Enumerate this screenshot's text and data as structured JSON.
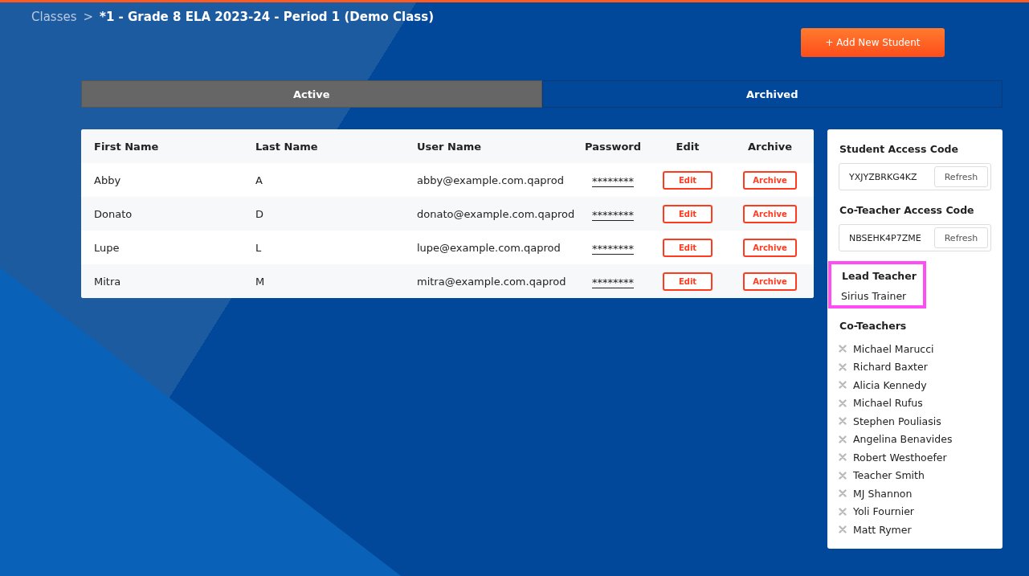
{
  "breadcrumb": {
    "parent": "Classes",
    "separator": ">",
    "current": "*1 - Grade 8 ELA 2023-24 - Period 1 (Demo Class)"
  },
  "add_button": {
    "label": "+ Add New Student"
  },
  "tabs": [
    {
      "label": "Active",
      "selected": true
    },
    {
      "label": "Archived",
      "selected": false
    }
  ],
  "table": {
    "columns": [
      "First Name",
      "Last Name",
      "User Name",
      "Password",
      "Edit",
      "Archive"
    ],
    "rows": [
      {
        "first_name": "Abby",
        "last_name": "A",
        "user_name": "abby@example.com.qaprod",
        "password": "********",
        "edit": "Edit",
        "archive": "Archive"
      },
      {
        "first_name": "Donato",
        "last_name": "D",
        "user_name": "donato@example.com.qaprod",
        "password": "********",
        "edit": "Edit",
        "archive": "Archive"
      },
      {
        "first_name": "Lupe",
        "last_name": "L",
        "user_name": "lupe@example.com.qaprod",
        "password": "********",
        "edit": "Edit",
        "archive": "Archive"
      },
      {
        "first_name": "Mitra",
        "last_name": "M",
        "user_name": "mitra@example.com.qaprod",
        "password": "********",
        "edit": "Edit",
        "archive": "Archive"
      }
    ]
  },
  "side_panel": {
    "access_codes": [
      {
        "title": "Student Access Code",
        "code": "YXJYZBRKG4KZ",
        "button": "Refresh"
      },
      {
        "title": "Co-Teacher Access Code",
        "code": "NBSEHK4P7ZME",
        "button": "Refresh"
      }
    ],
    "lead_teacher": {
      "title": "Lead Teacher",
      "name": "Sirius Trainer",
      "highlighted": true
    },
    "co_teachers": {
      "title": "Co-Teachers",
      "names": [
        "Michael Marucci",
        "Richard Baxter",
        "Alicia Kennedy",
        "Michael Rufus",
        "Stephen Pouliasis",
        "Angelina Benavides",
        "Robert Westhoefer",
        "Teacher Smith",
        "MJ Shannon",
        "Yoli Fournier",
        "Matt Rymer"
      ]
    }
  }
}
